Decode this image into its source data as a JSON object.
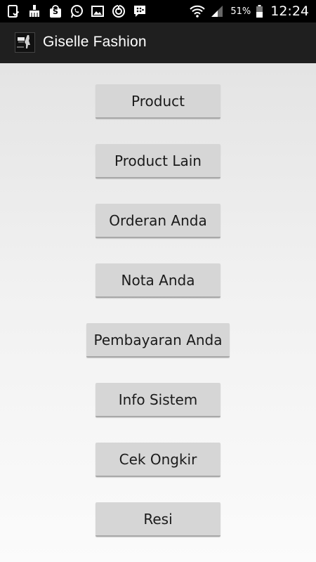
{
  "status_bar": {
    "icons_left": [
      "clipboard-check-icon",
      "cleaning-brush-icon",
      "shopping-bag-icon",
      "whatsapp-icon",
      "image-icon",
      "sync-circle-icon",
      "bbm-chat-icon"
    ],
    "shopping_bag_letter": "S",
    "battery_percent": "51%",
    "time": "12:24"
  },
  "action_bar": {
    "title": "Giselle Fashion",
    "background_color": "#1f1f1f"
  },
  "menu": {
    "product": "Product",
    "product_lain": "Product Lain",
    "orderan_anda": "Orderan Anda",
    "nota_anda": "Nota Anda",
    "pembayaran_anda": "Pembayaran Anda",
    "info_sistem": "Info Sistem",
    "cek_ongkir": "Cek Ongkir",
    "resi": "Resi"
  }
}
